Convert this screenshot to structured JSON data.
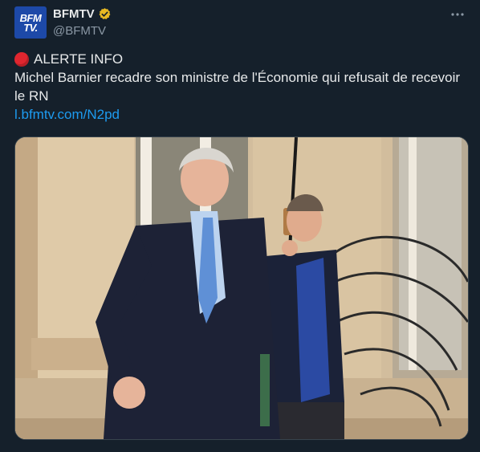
{
  "account": {
    "name": "BFMTV",
    "handle": "@BFMTV",
    "avatar_line1": "BFM",
    "avatar_line2": "TV."
  },
  "tweet": {
    "alert": "ALERTE INFO",
    "text": "Michel Barnier recadre son ministre de l'Économie qui refusait de recevoir le RN",
    "link": "l.bfmtv.com/N2pd"
  },
  "icons": {
    "verified": "verified-badge-gold",
    "more": "more-horizontal",
    "alert": "red-circle"
  },
  "colors": {
    "background": "#15202b",
    "link": "#1d9bf0",
    "verified": "#e8b923",
    "alert": "#e0262f",
    "avatar": "#1d49a8"
  }
}
